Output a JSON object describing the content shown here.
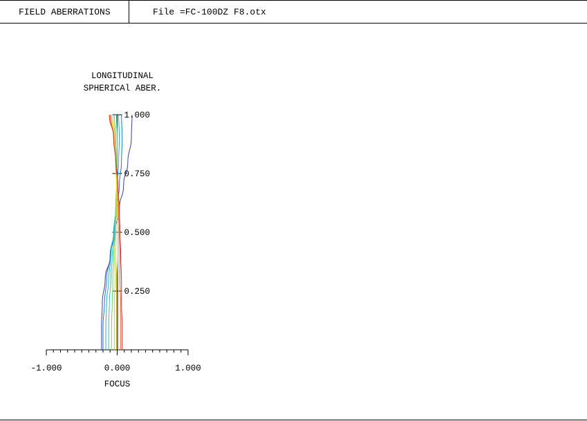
{
  "header": {
    "title": "FIELD ABERRATIONS",
    "file_label": "File =FC-100DZ F8.otx"
  },
  "chart_data": {
    "type": "line",
    "title_line1": "LONGITUDINAL",
    "title_line2": "SPHERICAl ABER.",
    "xlabel": "FOCUS",
    "xlim": [
      -1.0,
      1.0
    ],
    "ylim": [
      0,
      1.0
    ],
    "x_tick_labels": [
      "-1.000",
      "0.000",
      "1.000"
    ],
    "y_tick_values": [
      1.0,
      0.75,
      0.5,
      0.25
    ],
    "y_tick_labels": [
      "1.000",
      "0.750",
      "0.500",
      "0.250"
    ],
    "series": [
      {
        "color": "#3b3bb0",
        "points": [
          [
            -0.22,
            0
          ],
          [
            -0.22,
            0.1
          ],
          [
            -0.21,
            0.2
          ],
          [
            -0.17,
            0.3
          ],
          [
            -0.1,
            0.4
          ],
          [
            -0.03,
            0.5
          ],
          [
            0.03,
            0.6
          ],
          [
            0.09,
            0.7
          ],
          [
            0.15,
            0.8
          ],
          [
            0.2,
            0.9
          ],
          [
            0.21,
            1.0
          ]
        ]
      },
      {
        "color": "#1a78c8",
        "points": [
          [
            -0.2,
            0
          ],
          [
            -0.2,
            0.1
          ],
          [
            -0.18,
            0.2
          ],
          [
            -0.15,
            0.3
          ],
          [
            -0.1,
            0.4
          ],
          [
            -0.05,
            0.5
          ],
          [
            0.0,
            0.6
          ],
          [
            0.03,
            0.7
          ],
          [
            0.06,
            0.8
          ],
          [
            0.07,
            0.9
          ],
          [
            0.06,
            1.0
          ]
        ]
      },
      {
        "color": "#1ab0d0",
        "points": [
          [
            -0.16,
            0
          ],
          [
            -0.16,
            0.1
          ],
          [
            -0.15,
            0.2
          ],
          [
            -0.12,
            0.3
          ],
          [
            -0.09,
            0.4
          ],
          [
            -0.05,
            0.5
          ],
          [
            -0.02,
            0.6
          ],
          [
            0.0,
            0.7
          ],
          [
            0.02,
            0.8
          ],
          [
            0.03,
            0.9
          ],
          [
            0.02,
            1.0
          ]
        ]
      },
      {
        "color": "#28c8a8",
        "points": [
          [
            -0.12,
            0
          ],
          [
            -0.12,
            0.1
          ],
          [
            -0.11,
            0.2
          ],
          [
            -0.09,
            0.3
          ],
          [
            -0.07,
            0.4
          ],
          [
            -0.04,
            0.5
          ],
          [
            -0.02,
            0.6
          ],
          [
            -0.01,
            0.7
          ],
          [
            0.0,
            0.8
          ],
          [
            0.0,
            0.9
          ],
          [
            -0.01,
            1.0
          ]
        ]
      },
      {
        "color": "#70d070",
        "points": [
          [
            -0.08,
            0
          ],
          [
            -0.08,
            0.1
          ],
          [
            -0.07,
            0.2
          ],
          [
            -0.06,
            0.3
          ],
          [
            -0.05,
            0.4
          ],
          [
            -0.03,
            0.5
          ],
          [
            -0.02,
            0.6
          ],
          [
            -0.01,
            0.7
          ],
          [
            -0.01,
            0.8
          ],
          [
            -0.02,
            0.9
          ],
          [
            -0.04,
            1.0
          ]
        ]
      },
      {
        "color": "#b8d840",
        "points": [
          [
            -0.04,
            0
          ],
          [
            -0.04,
            0.1
          ],
          [
            -0.04,
            0.2
          ],
          [
            -0.03,
            0.3
          ],
          [
            -0.03,
            0.4
          ],
          [
            -0.02,
            0.5
          ],
          [
            -0.01,
            0.6
          ],
          [
            -0.01,
            0.7
          ],
          [
            -0.02,
            0.8
          ],
          [
            -0.03,
            0.9
          ],
          [
            -0.06,
            1.0
          ]
        ]
      },
      {
        "color": "#e8d830",
        "points": [
          [
            -0.01,
            0
          ],
          [
            -0.01,
            0.1
          ],
          [
            -0.01,
            0.2
          ],
          [
            -0.01,
            0.3
          ],
          [
            0.0,
            0.4
          ],
          [
            0.0,
            0.5
          ],
          [
            0.0,
            0.6
          ],
          [
            -0.01,
            0.7
          ],
          [
            -0.02,
            0.8
          ],
          [
            -0.04,
            0.9
          ],
          [
            -0.08,
            1.0
          ]
        ]
      },
      {
        "color": "#f0b030",
        "points": [
          [
            0.02,
            0
          ],
          [
            0.02,
            0.1
          ],
          [
            0.02,
            0.2
          ],
          [
            0.02,
            0.3
          ],
          [
            0.02,
            0.4
          ],
          [
            0.02,
            0.5
          ],
          [
            0.01,
            0.6
          ],
          [
            0.0,
            0.7
          ],
          [
            -0.02,
            0.8
          ],
          [
            -0.05,
            0.9
          ],
          [
            -0.09,
            1.0
          ]
        ]
      },
      {
        "color": "#e87040",
        "points": [
          [
            0.05,
            0
          ],
          [
            0.05,
            0.1
          ],
          [
            0.05,
            0.2
          ],
          [
            0.04,
            0.3
          ],
          [
            0.04,
            0.4
          ],
          [
            0.03,
            0.5
          ],
          [
            0.02,
            0.6
          ],
          [
            0.01,
            0.7
          ],
          [
            -0.02,
            0.8
          ],
          [
            -0.05,
            0.9
          ],
          [
            -0.1,
            1.0
          ]
        ]
      },
      {
        "color": "#d83030",
        "points": [
          [
            0.07,
            0
          ],
          [
            0.07,
            0.1
          ],
          [
            0.06,
            0.2
          ],
          [
            0.06,
            0.3
          ],
          [
            0.05,
            0.4
          ],
          [
            0.04,
            0.5
          ],
          [
            0.03,
            0.6
          ],
          [
            0.01,
            0.7
          ],
          [
            -0.02,
            0.8
          ],
          [
            -0.05,
            0.9
          ],
          [
            -0.11,
            1.0
          ]
        ]
      }
    ]
  }
}
